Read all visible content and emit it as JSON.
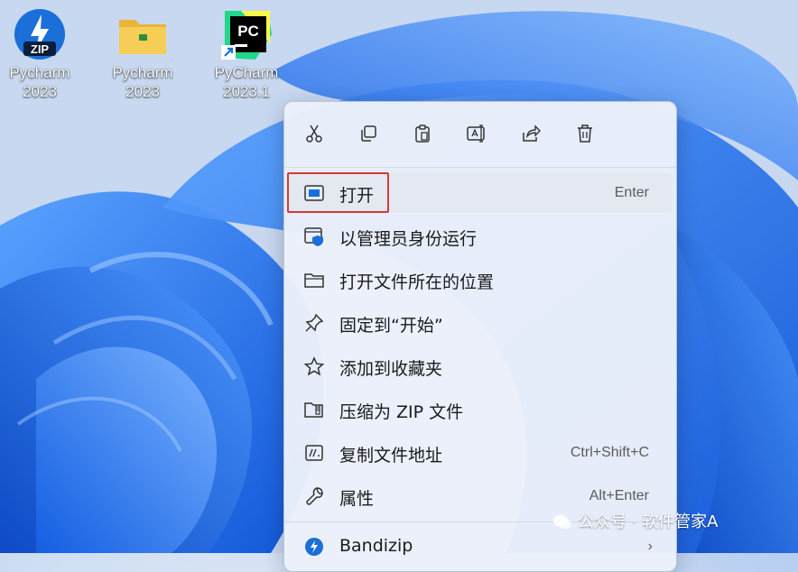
{
  "desktop": {
    "icons": [
      {
        "line1": "Pycharm",
        "line2": "2023",
        "icon": "zip-archive-icon"
      },
      {
        "line1": "Pycharm",
        "line2": "2023",
        "icon": "folder-icon"
      },
      {
        "line1": "PyCharm",
        "line2": "2023.1",
        "icon": "pycharm-shortcut-icon",
        "badge": "PC"
      }
    ]
  },
  "context_menu": {
    "toolbar": [
      {
        "name": "cut",
        "icon": "scissors-icon"
      },
      {
        "name": "copy",
        "icon": "copy-icon"
      },
      {
        "name": "paste",
        "icon": "clipboard-icon"
      },
      {
        "name": "rename",
        "icon": "rename-icon"
      },
      {
        "name": "share",
        "icon": "share-icon"
      },
      {
        "name": "delete",
        "icon": "trash-icon"
      }
    ],
    "items": [
      {
        "label": "打开",
        "shortcut": "Enter",
        "icon": "open-window-icon",
        "highlighted": true
      },
      {
        "label": "以管理员身份运行",
        "shortcut": "",
        "icon": "shield-window-icon"
      },
      {
        "label": "打开文件所在的位置",
        "shortcut": "",
        "icon": "folder-icon"
      },
      {
        "label": "固定到“开始”",
        "shortcut": "",
        "icon": "pin-icon"
      },
      {
        "label": "添加到收藏夹",
        "shortcut": "",
        "icon": "star-icon"
      },
      {
        "label": "压缩为 ZIP 文件",
        "shortcut": "",
        "icon": "zip-folder-icon"
      },
      {
        "label": "复制文件地址",
        "shortcut": "Ctrl+Shift+C",
        "icon": "copy-path-icon"
      },
      {
        "label": "属性",
        "shortcut": "Alt+Enter",
        "icon": "wrench-icon"
      },
      {
        "label": "Bandizip",
        "shortcut": "",
        "icon": "bandizip-icon",
        "has_submenu": true
      }
    ]
  },
  "watermark": {
    "text": "公众号 · 软件管家A"
  },
  "colors": {
    "accent": "#1a6fd8",
    "highlight_border": "#d63a34",
    "wallpaper_blue": "#1f6ff0",
    "menu_bg": "#ecf1fa"
  }
}
